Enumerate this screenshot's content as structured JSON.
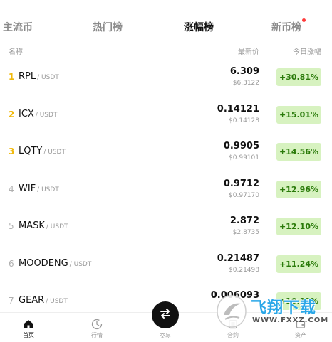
{
  "tabs": [
    {
      "label": "主流币",
      "active": false
    },
    {
      "label": "热门榜",
      "active": false
    },
    {
      "label": "涨幅榜",
      "active": true
    },
    {
      "label": "新币榜",
      "active": false,
      "dot": true
    }
  ],
  "columns": {
    "name": "名称",
    "price": "最新价",
    "change": "今日涨幅"
  },
  "rows": [
    {
      "rank": "1",
      "symbol": "RPL",
      "quote": "/ USDT",
      "price": "6.309",
      "usd": "$6.3122",
      "change": "+30.81%"
    },
    {
      "rank": "2",
      "symbol": "ICX",
      "quote": "/ USDT",
      "price": "0.14121",
      "usd": "$0.14128",
      "change": "+15.01%"
    },
    {
      "rank": "3",
      "symbol": "LQTY",
      "quote": "/ USDT",
      "price": "0.9905",
      "usd": "$0.99101",
      "change": "+14.56%"
    },
    {
      "rank": "4",
      "symbol": "WIF",
      "quote": "/ USDT",
      "price": "0.9712",
      "usd": "$0.97170",
      "change": "+12.96%"
    },
    {
      "rank": "5",
      "symbol": "MASK",
      "quote": "/ USDT",
      "price": "2.872",
      "usd": "$2.8735",
      "change": "+12.10%"
    },
    {
      "rank": "6",
      "symbol": "MOODENG",
      "quote": "/ USDT",
      "price": "0.21487",
      "usd": "$0.21498",
      "change": "+11.24%"
    },
    {
      "rank": "7",
      "symbol": "GEAR",
      "quote": "/ USDT",
      "price": "0.006093",
      "usd": "",
      "change": "+10.12%"
    }
  ],
  "bottom_nav": [
    {
      "label": "首页",
      "icon": "home-icon",
      "active": true
    },
    {
      "label": "行情",
      "icon": "market-icon",
      "active": false
    },
    {
      "label": "交易",
      "icon": "swap-icon",
      "active": false
    },
    {
      "label": "合约",
      "icon": "contract-icon",
      "active": false
    },
    {
      "label": "资产",
      "icon": "wallet-icon",
      "active": false
    }
  ],
  "watermark": {
    "text": "飞翔下载",
    "url": "WWW.FXXZ.COM"
  },
  "colors": {
    "accent_rank": "#f0b90b",
    "change_bg": "#d7f2c0",
    "change_text": "#2a7a0a"
  }
}
